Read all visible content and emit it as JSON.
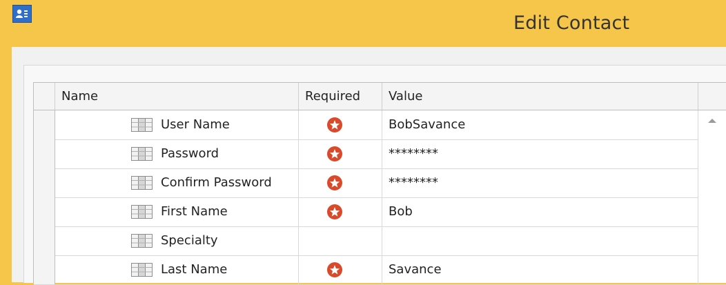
{
  "window": {
    "title": "Edit Contact",
    "icon": "contact-card-icon",
    "colors": {
      "titlebar": "#f5c64a",
      "accent": "#2f6fc9",
      "required": "#d94a2b"
    }
  },
  "grid": {
    "columns": [
      "Name",
      "Required",
      "Value"
    ],
    "rows": [
      {
        "name": "User Name",
        "required": true,
        "value": "BobSavance"
      },
      {
        "name": "Password",
        "required": true,
        "value": "********"
      },
      {
        "name": "Confirm Password",
        "required": true,
        "value": "********"
      },
      {
        "name": "First Name",
        "required": true,
        "value": "Bob"
      },
      {
        "name": "Specialty",
        "required": false,
        "value": ""
      },
      {
        "name": "Last Name",
        "required": true,
        "value": "Savance"
      }
    ],
    "field_icon": "table-field-icon",
    "required_icon": "required-star-icon"
  }
}
